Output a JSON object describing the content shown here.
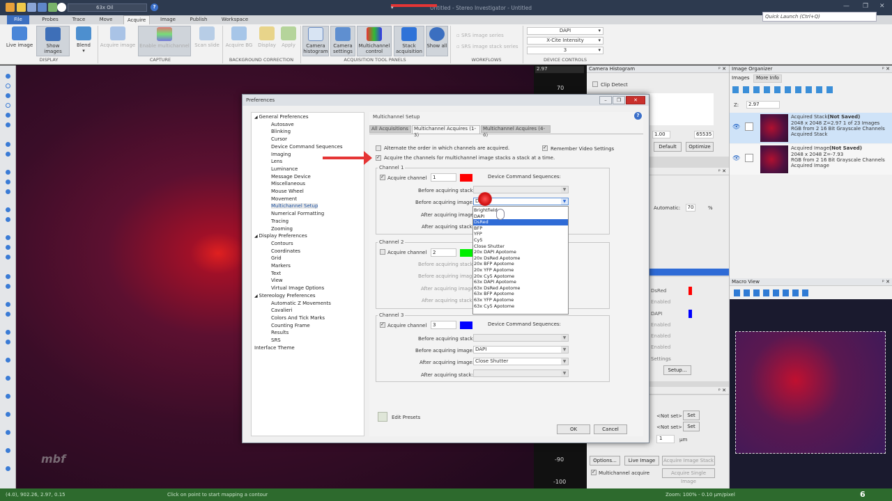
{
  "titlebar": {
    "lens": "63x Oil",
    "title": "Untitled - Stereo Investigator - Untitled",
    "quick_launch": "Quick Launch (Ctrl+Q)"
  },
  "menu": [
    "File",
    "Probes",
    "Trace",
    "Move",
    "Acquire",
    "Image",
    "Publish",
    "Workspace"
  ],
  "ribbon": {
    "display": {
      "live_image": "Live image",
      "show_images": "Show images",
      "blend": "Blend",
      "label": "DISPLAY"
    },
    "capture": {
      "acquire_image": "Acquire image",
      "enable_multichannel": "Enable multichannel",
      "scan_slide": "Scan slide",
      "label": "CAPTURE"
    },
    "background": {
      "acquire_bg": "Acquire BG",
      "display": "Display",
      "apply": "Apply",
      "label": "BACKGROUND CORRECTION"
    },
    "acq_tools": {
      "camera_histogram": "Camera histogram",
      "camera_settings": "Camera settings",
      "multichannel_control": "Multichannel control",
      "stack_acquisition": "Stack acquisition",
      "show_all": "Show all",
      "label": "ACQUISITION TOOL PANELS"
    },
    "workflows": {
      "srs_image_series": "SRS image series",
      "srs_image_stack_series": "SRS image stack series",
      "label": "WORKFLOWS"
    },
    "device_controls": {
      "sel1": "DAPI",
      "sel2": "X-Cite Intensity",
      "sel3": "3",
      "label": "DEVICE CONTROLS"
    }
  },
  "ruler": {
    "top_value": "2.97",
    "tick_70": "70",
    "tick_m90": "-90",
    "tick_m100": "-100"
  },
  "camera_histogram": {
    "title": "Camera Histogram",
    "clip_detect": "Clip Detect",
    "min_val": "1.00",
    "max_val": "65535",
    "default_btn": "Default",
    "optimize_btn": "Optimize",
    "automatic": "Automatic:",
    "auto_val": "70",
    "pct": "%"
  },
  "mc_panel": {
    "rows": [
      {
        "name": "DsRed",
        "color": "#ff0000",
        "enabled": "Enabled"
      },
      {
        "name": "DAPI",
        "color": "#0000ff",
        "enabled": "Enabled"
      }
    ],
    "extra_enabled": [
      "Enabled",
      "Enabled",
      "Enabled"
    ],
    "settings": "Settings",
    "setup_btn": "Setup..."
  },
  "stack_panel": {
    "not_set_1": "<Not set>",
    "not_set_2": "<Not set>",
    "set_btn": "Set",
    "step_val": "1",
    "um": "µm",
    "options_btn": "Options...",
    "live_image_btn": "Live Image",
    "acq_stack_btn": "Acquire Image Stack",
    "mc_acquire": "Multichannel acquire",
    "acq_single_btn": "Acquire Single Image"
  },
  "image_organizer": {
    "title": "Image Organizer",
    "tabs": [
      "Images",
      "More Info"
    ],
    "z_label": "Z:",
    "z_value": "2.97",
    "items": [
      {
        "title": "Acquired Stack",
        "status": "(Not Saved)",
        "line2": "2048 x 2048  Z=2.97  1 of 23 Images",
        "line3": "RGB from 2 16 Bit Grayscale Channels",
        "line4": "Acquired Stack"
      },
      {
        "title": "Acquired Image",
        "status": "(Not Saved)",
        "line2": "2048 x 2048  Z=-7.93",
        "line3": "RGB from 2 16 Bit Grayscale Channels",
        "line4": "Acquired Image"
      }
    ]
  },
  "macro_view": {
    "title": "Macro View"
  },
  "status": {
    "left": "(4.0), 902.26, 2.97, 0.15",
    "hint": "Click on point to start mapping a contour",
    "zoom": "Zoom: 100% - 0.10 µm/pixel",
    "badge": "6"
  },
  "preferences": {
    "title": "Preferences",
    "tree": [
      {
        "label": "General Preferences",
        "level": 0,
        "exp": "◢"
      },
      {
        "label": "Autosave",
        "level": 2
      },
      {
        "label": "Blinking",
        "level": 2
      },
      {
        "label": "Cursor",
        "level": 2
      },
      {
        "label": "Device Command Sequences",
        "level": 2
      },
      {
        "label": "Imaging",
        "level": 2
      },
      {
        "label": "Lens",
        "level": 2
      },
      {
        "label": "Luminance",
        "level": 2
      },
      {
        "label": "Message Device",
        "level": 2
      },
      {
        "label": "Miscellaneous",
        "level": 2
      },
      {
        "label": "Mouse Wheel",
        "level": 2
      },
      {
        "label": "Movement",
        "level": 2
      },
      {
        "label": "Multichannel Setup",
        "level": 2,
        "selected": true
      },
      {
        "label": "Numerical Formatting",
        "level": 2
      },
      {
        "label": "Tracing",
        "level": 2
      },
      {
        "label": "Zooming",
        "level": 2
      },
      {
        "label": "Display Preferences",
        "level": 0,
        "exp": "◢"
      },
      {
        "label": "Contours",
        "level": 2
      },
      {
        "label": "Coordinates",
        "level": 2
      },
      {
        "label": "Grid",
        "level": 2
      },
      {
        "label": "Markers",
        "level": 2
      },
      {
        "label": "Text",
        "level": 2
      },
      {
        "label": "View",
        "level": 2
      },
      {
        "label": "Virtual Image Options",
        "level": 2
      },
      {
        "label": "Stereology Preferences",
        "level": 0,
        "exp": "◢"
      },
      {
        "label": "Automatic Z Movements",
        "level": 2
      },
      {
        "label": "Cavalieri",
        "level": 2
      },
      {
        "label": "Colors And Tick Marks",
        "level": 2
      },
      {
        "label": "Counting Frame",
        "level": 2
      },
      {
        "label": "Results",
        "level": 2
      },
      {
        "label": "SRS",
        "level": 2
      },
      {
        "label": "Interface Theme",
        "level": 0
      }
    ],
    "section_title": "Multichannel Setup",
    "tabs": [
      "All Acquisitions",
      "Multichannel Acquires (1-3)",
      "Multichannel Acquires (4-6)"
    ],
    "alternate_order": "Alternate the order in which channels are acquired.",
    "remember_video": "Remember Video Settings",
    "acquire_stack_at_time": "Acquire the channels for multichannel image stacks a stack at a time.",
    "channels": [
      {
        "title": "Channel 1",
        "acquire": "Acquire channel",
        "num": "1",
        "color": "#ff0000",
        "dcs": "Device Command Sequences:",
        "before_stack": "Before acquiring stack:",
        "before_image": "Before acquiring  image:",
        "after_image": "After acquiring image:",
        "after_stack": "After acquiring stack:",
        "before_stack_val": "",
        "before_image_val": "DsRed",
        "after_image_val": "",
        "after_stack_val": ""
      },
      {
        "title": "Channel 2",
        "acquire": "Acquire channel",
        "num": "2",
        "color": "#00ee00",
        "before_stack": "Before acquiring stack:",
        "before_image": "Before acquiring image:",
        "after_image": "After acquiring image:",
        "after_stack": "After acquiring stack:"
      },
      {
        "title": "Channel 3",
        "acquire": "Acquire channel",
        "num": "3",
        "color": "#0000ff",
        "dcs": "Device Command Sequences:",
        "before_stack": "Before acquiring stack:",
        "before_image": "Before acquiring image:",
        "after_image": "After acquiring image:",
        "after_stack": "After acquiring stack:",
        "before_stack_val": "",
        "before_image_val": "DAPI",
        "after_image_val": "Close Shutter",
        "after_stack_val": ""
      }
    ],
    "dropdown_options": [
      "Brightfield",
      "DAPI",
      "DsRed",
      "BFP",
      "YFP",
      "Cy5",
      "Close Shutter",
      "20x DAPI Apotome",
      "20x DsRed Apotome",
      "20x BFP Apotome",
      "20x YFP Apotome",
      "20x Cy5 Apotome",
      "63x DAPI Apotome",
      "63x DsRed Apotome",
      "63x BFP Apotome",
      "63x YFP Apotome",
      "63x Cy5 Apotome"
    ],
    "dropdown_selected": "DsRed",
    "edit_presets": "Edit Presets",
    "ok": "OK",
    "cancel": "Cancel"
  }
}
